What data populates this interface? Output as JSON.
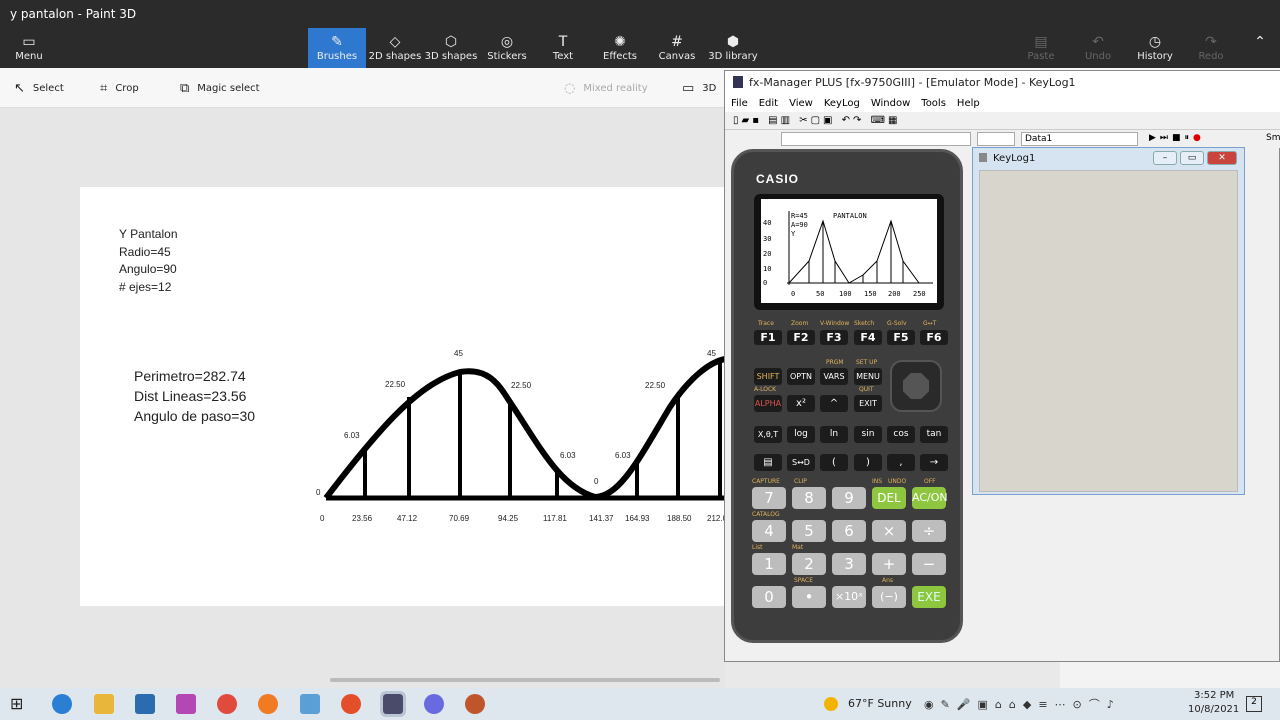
{
  "window": {
    "title": "y pantalon - Paint 3D"
  },
  "ribbon": {
    "menu": "Menu",
    "tools": [
      "Brushes",
      "2D shapes",
      "3D shapes",
      "Stickers",
      "Text",
      "Effects",
      "Canvas",
      "3D library"
    ],
    "right": [
      "Paste",
      "Undo",
      "History",
      "Redo"
    ]
  },
  "toolbar": {
    "select": "Select",
    "crop": "Crop",
    "magic": "Magic select",
    "mixed": "Mixed reality",
    "view3d": "3D"
  },
  "paper": {
    "title_lines": [
      "Y Pantalon",
      "Radio=45",
      "Angulo=90",
      "# ejes=12"
    ],
    "info_lines": [
      "Perimetro=282.74",
      "Dist Lineas=23.56",
      "Angulo de paso=30"
    ],
    "x_ticks": [
      "0",
      "23.56",
      "47.12",
      "70.69",
      "94.25",
      "117.81",
      "141.37",
      "164.93",
      "188.50",
      "212.0"
    ],
    "y_labels": [
      "0",
      "6.03",
      "22.50",
      "45",
      "22.50",
      "6.03",
      "0",
      "6.03",
      "22.50",
      "45"
    ]
  },
  "fx": {
    "title": "fx-Manager PLUS [fx-9750GIII] - [Emulator Mode] - KeyLog1",
    "menu": [
      "File",
      "Edit",
      "View",
      "KeyLog",
      "Window",
      "Tools",
      "Help"
    ],
    "data_dd": "Data1",
    "sm": "Sm",
    "brand": "CASIO",
    "screen": {
      "r": "R=45",
      "a": "A=90",
      "y": "Y",
      "label": "PANTALON",
      "yticks": [
        "40",
        "30",
        "20",
        "10",
        "0"
      ],
      "xticks": [
        "0",
        "50",
        "100",
        "150",
        "200",
        "250"
      ]
    },
    "fkeys_top": [
      "Trace",
      "Zoom",
      "V-Window",
      "Sketch",
      "G-Solv",
      "G↔T"
    ],
    "fkeys": [
      "F1",
      "F2",
      "F3",
      "F4",
      "F5",
      "F6"
    ],
    "row1": [
      "SHIFT",
      "OPTN",
      "VARS",
      "MENU"
    ],
    "row2": [
      "ALPHA",
      "x²",
      "^",
      "EXIT"
    ],
    "row1top": [
      "PRGM",
      "SET UP"
    ],
    "row2top": [
      "A-LOCK",
      "QUIT"
    ],
    "row3": [
      "X,θ,T",
      "log",
      "ln",
      "sin",
      "cos",
      "tan"
    ],
    "row4": [
      "▤",
      "S↔D",
      "(",
      ")",
      ",",
      "→"
    ],
    "num1": [
      "7",
      "8",
      "9",
      "DEL",
      "AC/ON"
    ],
    "num2": [
      "4",
      "5",
      "6",
      "×",
      "÷"
    ],
    "num3": [
      "1",
      "2",
      "3",
      "+",
      "−"
    ],
    "num4": [
      "0",
      "•",
      "×10ˣ",
      "(−)",
      "EXE"
    ],
    "num1top": [
      "CAPTURE",
      "CLIP",
      "INS",
      "UNDO",
      "OFF"
    ],
    "num2top": [
      "CATALOG"
    ],
    "num3top": [
      "List",
      "Mat"
    ],
    "num4top": [
      "SPACE",
      "Ans"
    ],
    "keylog_title": "KeyLog1"
  },
  "taskbar": {
    "weather": "67°F  Sunny",
    "time": "3:52 PM",
    "date": "10/8/2021",
    "notif": "2"
  },
  "colors": {
    "accent": "#2f78d0",
    "dark": "#2b2b2b",
    "green": "#8ec63f"
  }
}
